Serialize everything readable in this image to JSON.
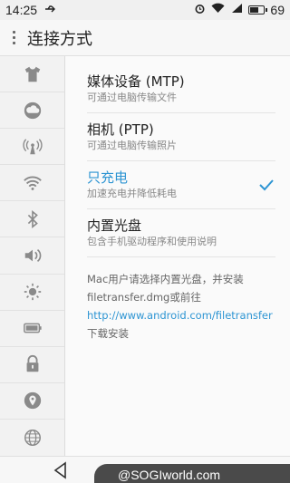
{
  "status_bar": {
    "time": "14:25",
    "usb_icon": "usb-icon",
    "battery_level": "69",
    "battery_fraction": 0.69
  },
  "title_bar": {
    "title": "连接方式"
  },
  "sidebar": {
    "items": [
      {
        "icon": "shirt-icon"
      },
      {
        "icon": "cloud-icon"
      },
      {
        "icon": "hotspot-icon"
      },
      {
        "icon": "wifi-icon"
      },
      {
        "icon": "bluetooth-icon"
      },
      {
        "icon": "sound-icon"
      },
      {
        "icon": "brightness-icon"
      },
      {
        "icon": "battery-icon"
      },
      {
        "icon": "lock-icon"
      },
      {
        "icon": "location-icon"
      },
      {
        "icon": "globe-icon"
      }
    ]
  },
  "options": [
    {
      "title": "媒体设备 (MTP)",
      "subtitle": "可通过电脑传输文件",
      "selected": false
    },
    {
      "title": "相机 (PTP)",
      "subtitle": "可通过电脑传输照片",
      "selected": false
    },
    {
      "title": "只充电",
      "subtitle": "加速充电并降低耗电",
      "selected": true
    },
    {
      "title": "内置光盘",
      "subtitle": "包含手机驱动程序和使用说明",
      "selected": false
    }
  ],
  "note": {
    "before": "Mac用户请选择内置光盘，并安装filetransfer.dmg或前往",
    "link": "http://www.android.com/filetransfer",
    "after": "下载安装"
  },
  "colors": {
    "accent": "#2e95d3"
  },
  "watermark": "@SOGIworld.com"
}
